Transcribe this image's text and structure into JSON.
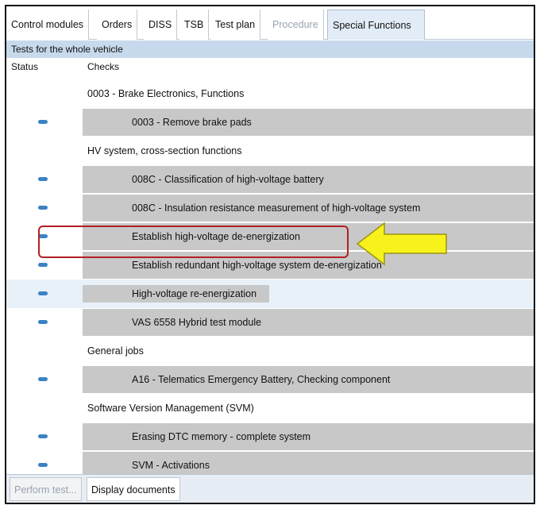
{
  "tabs": [
    {
      "label": "Control modules",
      "state": "normal"
    },
    {
      "label": "Orders",
      "state": "normal"
    },
    {
      "label": "DISS",
      "state": "normal"
    },
    {
      "label": "TSB",
      "state": "normal"
    },
    {
      "label": "Test plan",
      "state": "normal"
    },
    {
      "label": "Procedure",
      "state": "disabled"
    },
    {
      "label": "Special Functions",
      "state": "active"
    }
  ],
  "section_title": "Tests for the whole vehicle",
  "columns": {
    "status": "Status",
    "checks": "Checks"
  },
  "rows": [
    {
      "kind": "group",
      "label": "0003 - Brake Electronics, Functions"
    },
    {
      "kind": "check",
      "label": "0003  - Remove brake pads"
    },
    {
      "kind": "group",
      "label": "HV system, cross-section functions"
    },
    {
      "kind": "check",
      "label": "008C  - Classification of high-voltage battery"
    },
    {
      "kind": "check",
      "label": "008C  - Insulation resistance measurement of high-voltage system"
    },
    {
      "kind": "check",
      "label": "Establish high-voltage de-energization"
    },
    {
      "kind": "check",
      "label": "Establish redundant high-voltage system de-energization"
    },
    {
      "kind": "check",
      "label": "High-voltage re-energization",
      "selected": true
    },
    {
      "kind": "check",
      "label": "VAS 6558 Hybrid test module"
    },
    {
      "kind": "group",
      "label": "General jobs"
    },
    {
      "kind": "check",
      "label": "A16 - Telematics Emergency Battery, Checking component"
    },
    {
      "kind": "group",
      "label": "Software Version Management (SVM)"
    },
    {
      "kind": "check",
      "label": "Erasing DTC memory - complete system"
    },
    {
      "kind": "check",
      "label": "SVM - Activations"
    }
  ],
  "bottom_buttons": [
    {
      "label": "Perform test...",
      "state": "disabled"
    },
    {
      "label": "Display documents",
      "state": "normal"
    }
  ],
  "colors": {
    "status_dash": "#3b82c4",
    "highlight": "#b21f24",
    "arrow_fill": "#f7f21c"
  },
  "icons": {
    "status": "status-dash-icon",
    "annotation": "arrow-left-icon"
  }
}
